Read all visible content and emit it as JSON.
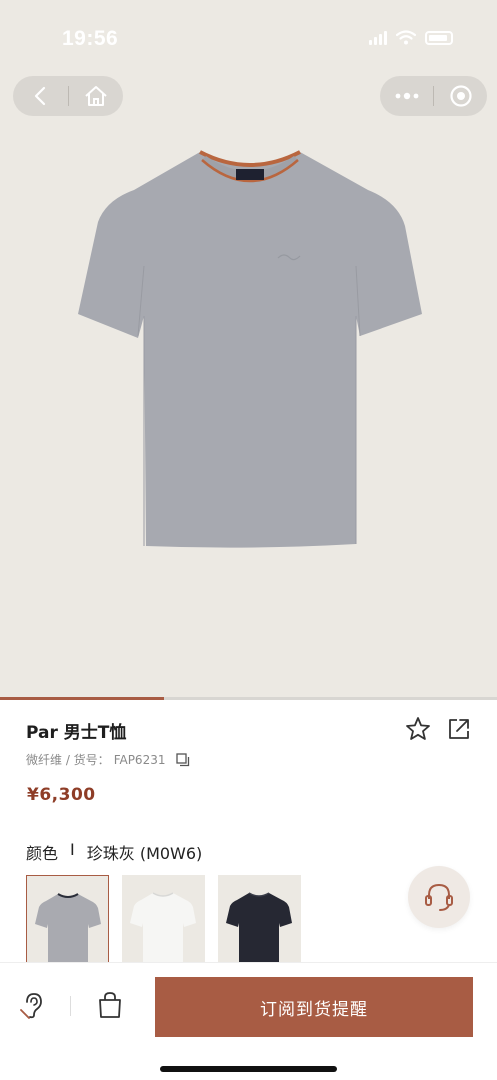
{
  "status_bar": {
    "time": "19:56",
    "icons": [
      "signal-icon",
      "wifi-icon",
      "battery-icon"
    ]
  },
  "nav": {
    "left_buttons": [
      "back-icon",
      "home-icon"
    ],
    "right_buttons": [
      "more-icon",
      "close-miniprogram-icon"
    ]
  },
  "gallery": {
    "progress": 0.33,
    "accent_color": "#a85c44"
  },
  "product": {
    "title": "Par 男士T恤",
    "material": "微纤维 / 货号：",
    "sku": "FAP6231",
    "price": "¥6,300",
    "color_label": "颜色",
    "color_separator": "I",
    "color_value": "珍珠灰 (M0W6)",
    "swatches": [
      {
        "name": "grey",
        "color": "#a9aab0",
        "selected": true
      },
      {
        "name": "white",
        "color": "#f4f4f2",
        "selected": false
      },
      {
        "name": "navy",
        "color": "#262833",
        "selected": false
      }
    ]
  },
  "bottom_bar": {
    "subscribe_label": "订阅到货提醒"
  },
  "colors": {
    "accent": "#a85c44",
    "price": "#8e3d27",
    "background": "#ece9e3"
  }
}
